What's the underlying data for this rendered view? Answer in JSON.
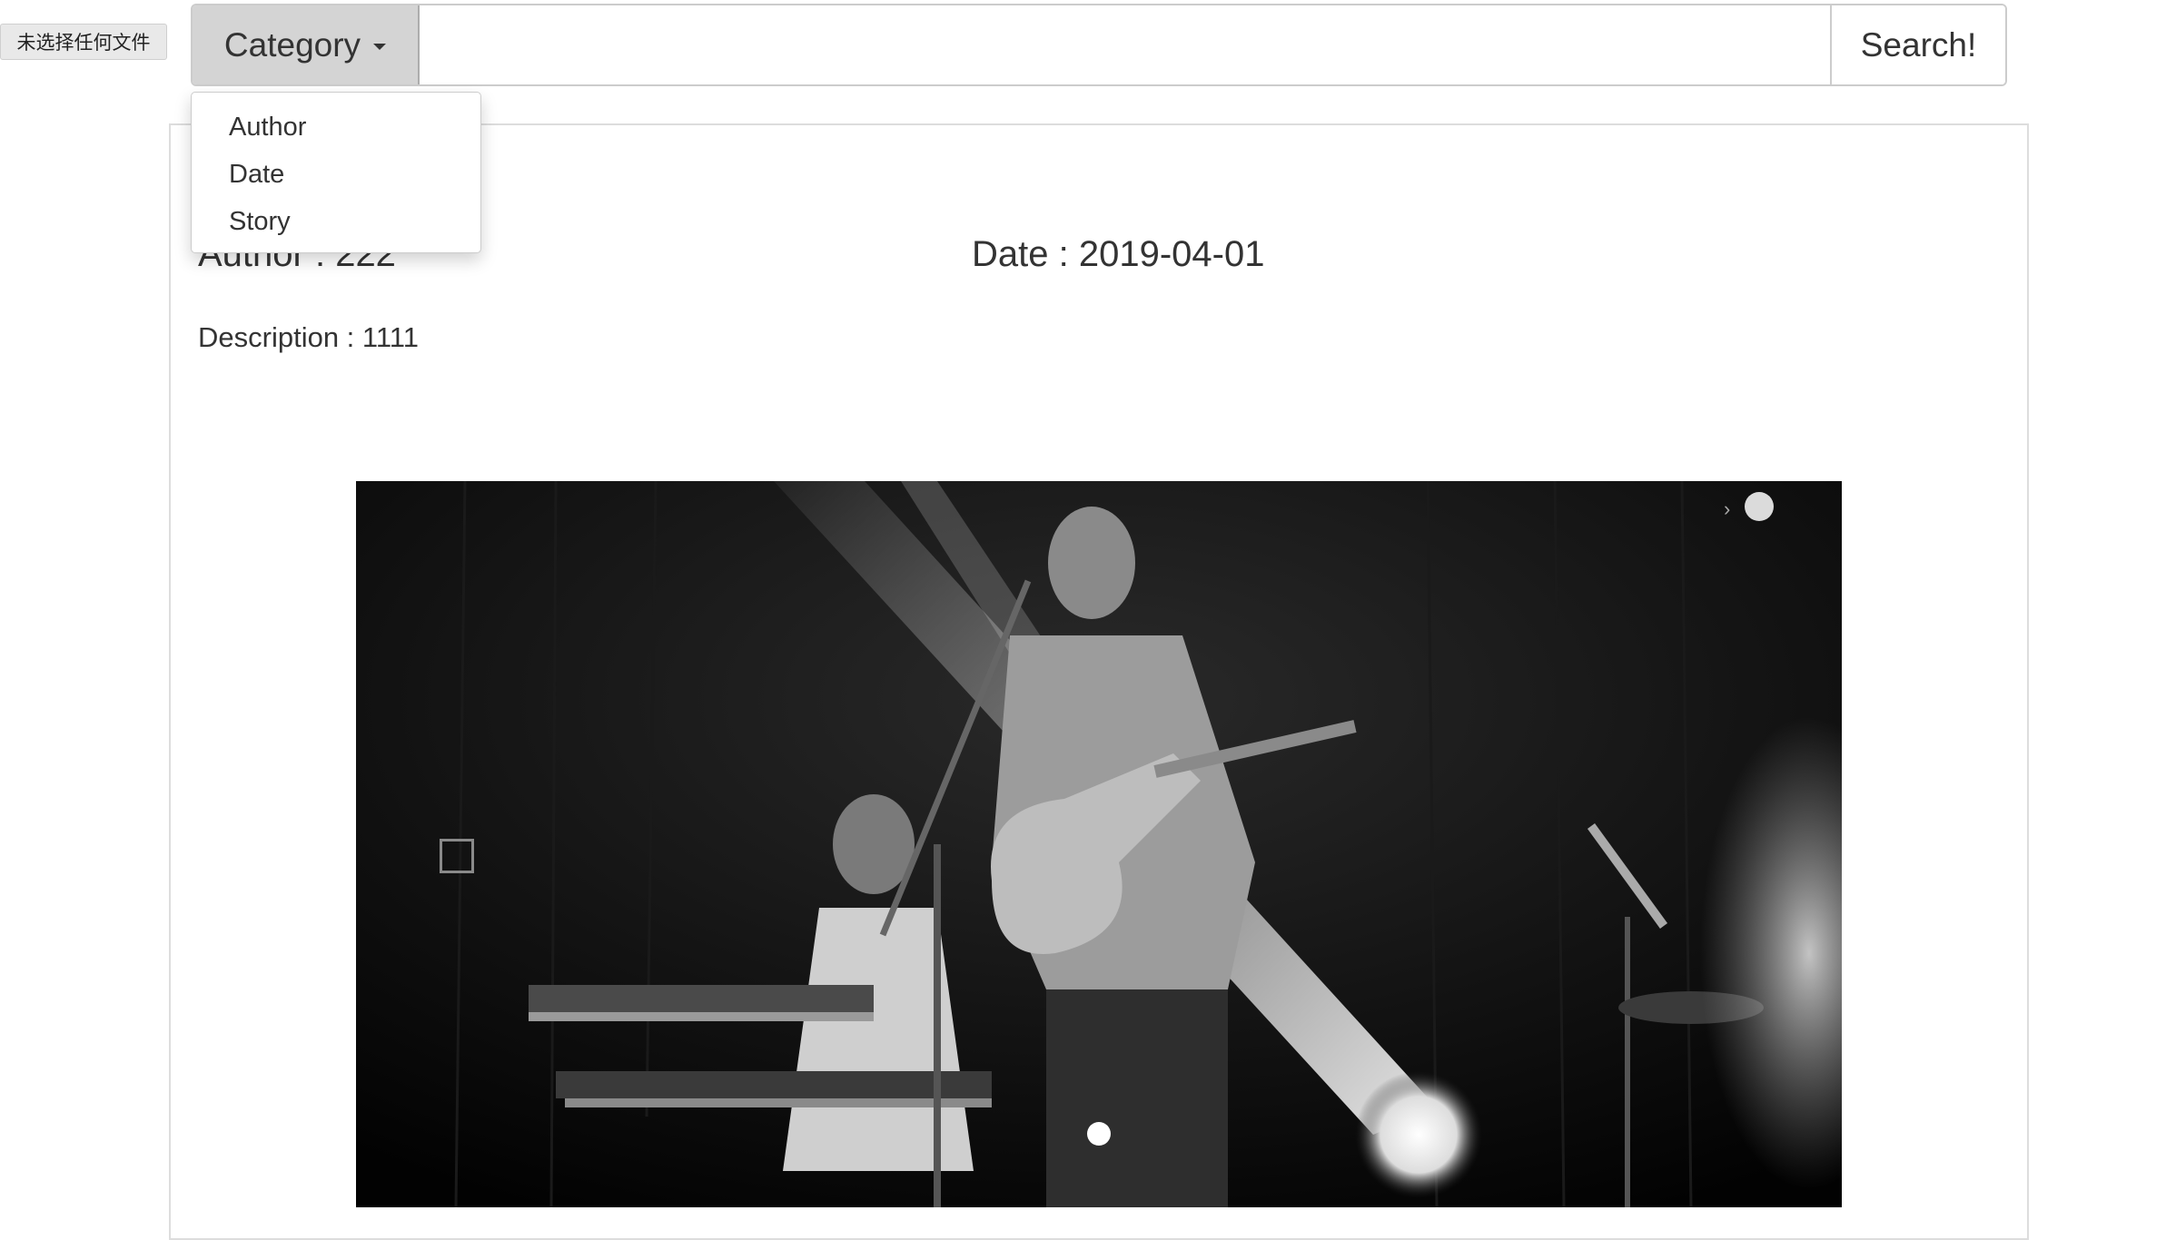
{
  "file_input": {
    "status_text": "未选择任何文件"
  },
  "search": {
    "category_label": "Category",
    "input_value": "",
    "input_placeholder": "",
    "button_label": "Search!"
  },
  "dropdown": {
    "items": [
      {
        "label": "Author"
      },
      {
        "label": "Date"
      },
      {
        "label": "Story"
      }
    ]
  },
  "post": {
    "author": "Author : 222",
    "date": "Date : 2019-04-01",
    "description": "Description : 1111"
  },
  "carousel": {
    "image_subject": "black-and-white concert photo with guitarist singing at microphone and keyboard player",
    "next_glyph": "›"
  },
  "colors": {
    "category_bg": "#d4d4d4",
    "border": "#cccccc",
    "text": "#333333"
  }
}
